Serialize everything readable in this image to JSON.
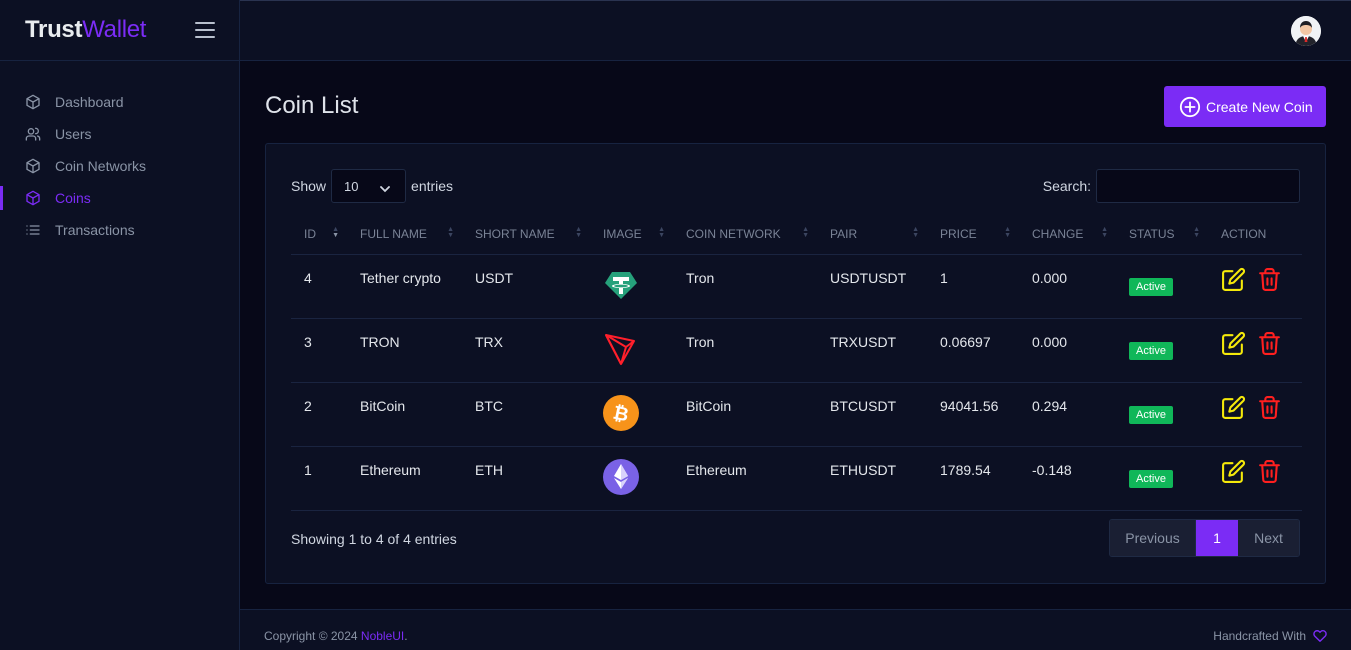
{
  "brand": {
    "part1": "Trust",
    "part2": "Wallet"
  },
  "sidebar": {
    "items": [
      {
        "label": "Dashboard",
        "icon": "box-icon"
      },
      {
        "label": "Users",
        "icon": "users-icon"
      },
      {
        "label": "Coin Networks",
        "icon": "box-icon"
      },
      {
        "label": "Coins",
        "icon": "box-icon",
        "active": true
      },
      {
        "label": "Transactions",
        "icon": "list-icon"
      }
    ]
  },
  "page": {
    "title": "Coin List",
    "create_label": "Create New Coin"
  },
  "table_controls": {
    "show_label": "Show",
    "entries_value": "10",
    "entries_label": "entries",
    "search_label": "Search:",
    "search_value": ""
  },
  "table": {
    "columns": [
      "ID",
      "FULL NAME",
      "SHORT NAME",
      "IMAGE",
      "COIN NETWORK",
      "PAIR",
      "PRICE",
      "CHANGE",
      "STATUS",
      "ACTION"
    ],
    "rows": [
      {
        "id": "4",
        "full_name": "Tether crypto",
        "short_name": "USDT",
        "image": "tether-logo",
        "network": "Tron",
        "pair": "USDTUSDT",
        "price": "1",
        "change": "0.000",
        "status": "Active"
      },
      {
        "id": "3",
        "full_name": "TRON",
        "short_name": "TRX",
        "image": "tron-logo",
        "network": "Tron",
        "pair": "TRXUSDT",
        "price": "0.06697",
        "change": "0.000",
        "status": "Active"
      },
      {
        "id": "2",
        "full_name": "BitCoin",
        "short_name": "BTC",
        "image": "bitcoin-logo",
        "network": "BitCoin",
        "pair": "BTCUSDT",
        "price": "94041.56",
        "change": "0.294",
        "status": "Active"
      },
      {
        "id": "1",
        "full_name": "Ethereum",
        "short_name": "ETH",
        "image": "ethereum-logo",
        "network": "Ethereum",
        "pair": "ETHUSDT",
        "price": "1789.54",
        "change": "-0.148",
        "status": "Active"
      }
    ],
    "info": "Showing 1 to 4 of 4 entries"
  },
  "pagination": {
    "prev": "Previous",
    "current": "1",
    "next": "Next"
  },
  "footer": {
    "copyright_prefix": "Copyright © 2024 ",
    "brand_link": "NobleUI",
    "copyright_suffix": ".",
    "handcrafted": "Handcrafted With"
  },
  "colors": {
    "accent": "#7b2cf5",
    "success": "#10b759",
    "edit": "#fbbc06",
    "delete": "#ff3366",
    "background": "#070818",
    "panel": "#0c1023"
  }
}
